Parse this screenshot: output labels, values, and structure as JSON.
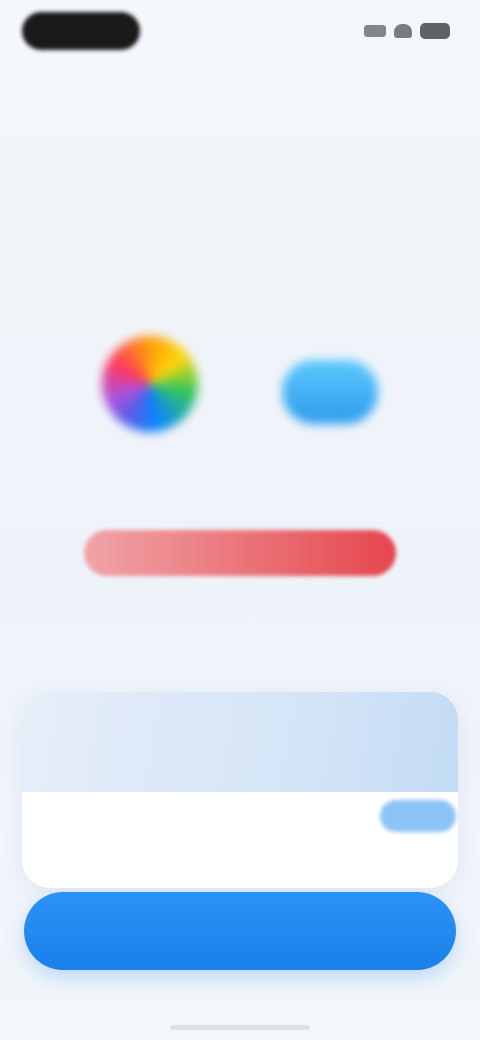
{
  "status_bar": {
    "back_label": "",
    "icons": [
      "signal-icon",
      "wifi-icon",
      "battery-icon"
    ]
  },
  "header": {
    "title": "",
    "subtitle": ""
  },
  "apps": [
    {
      "label": "",
      "icon": "photos-icon"
    },
    {
      "label": "",
      "icon": "icloud-icon"
    }
  ],
  "progress": {
    "fraction": 1.0,
    "text_main": "",
    "text_accent": ""
  },
  "card": {
    "title": "",
    "row_label": "",
    "badge": ""
  },
  "primary_button": {
    "label": ""
  },
  "footer": {
    "left": "",
    "right": ""
  },
  "colors": {
    "accent_blue": "#1a80ea",
    "progress_red": "#e5474d",
    "progress_track": "#f6c9cc",
    "card_tint": "#d4e4f7"
  }
}
